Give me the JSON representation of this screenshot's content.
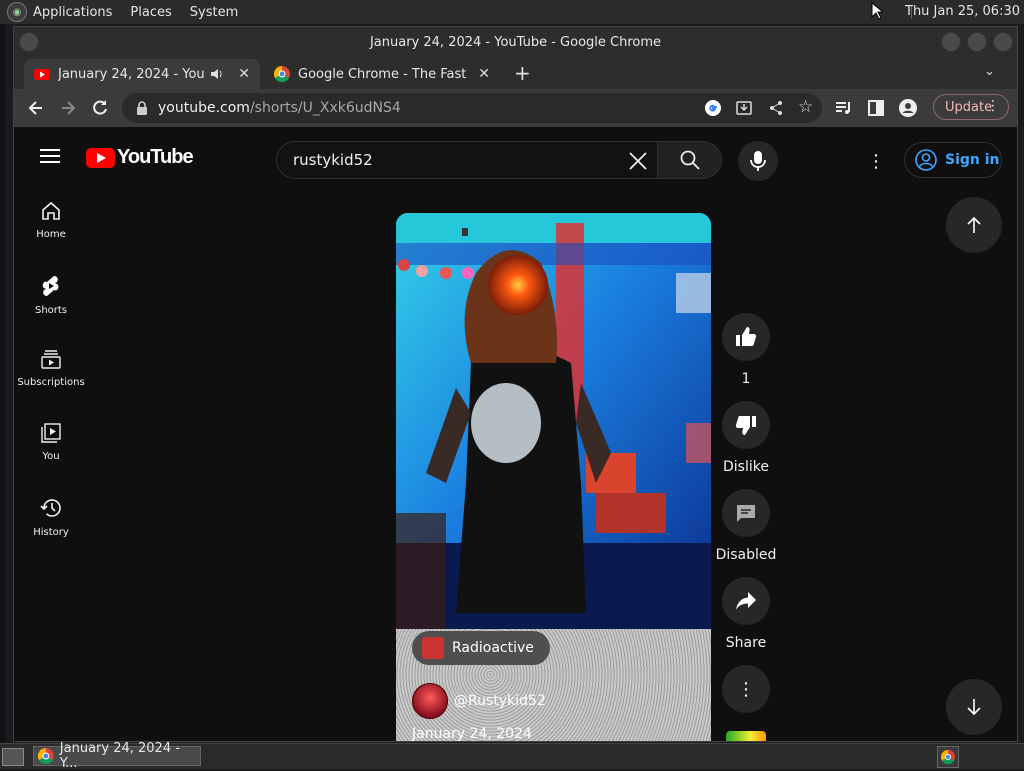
{
  "desktop": {
    "menu": [
      "Applications",
      "Places",
      "System"
    ],
    "clock": "Thu Jan 25, 06:30"
  },
  "window": {
    "title": "January 24, 2024 - YouTube - Google Chrome"
  },
  "tabs": [
    {
      "label": "January 24, 2024 - YouTube",
      "favicon": "youtube-icon",
      "audio": true
    },
    {
      "label": "Google Chrome - The Fast & Secure Web Browser",
      "favicon": "chrome-icon"
    }
  ],
  "address": {
    "host": "youtube.com",
    "path": "/shorts/U_Xxk6udNS4"
  },
  "toolbar": {
    "update_label": "Update"
  },
  "youtube": {
    "logo_text": "YouTube",
    "search_value": "rustykid52",
    "signin_label": "Sign in",
    "guide": [
      {
        "label": "Home",
        "icon": "home-icon"
      },
      {
        "label": "Shorts",
        "icon": "shorts-icon"
      },
      {
        "label": "Subscriptions",
        "icon": "subscriptions-icon"
      },
      {
        "label": "You",
        "icon": "you-icon"
      },
      {
        "label": "History",
        "icon": "history-icon"
      }
    ],
    "short": {
      "audio_label": "Radioactive",
      "channel": "@Rustykid52",
      "date": "January 24, 2024"
    },
    "actions": {
      "like_count": "1",
      "dislike_label": "Dislike",
      "comments_label": "Disabled",
      "share_label": "Share"
    }
  },
  "taskbar": {
    "item_label": "January 24, 2024 - Y..."
  },
  "colors": {
    "yt_red": "#ff0000",
    "yt_bg": "#0f0f0f",
    "signin_blue": "#3ea6ff",
    "update_text": "#f2b8b5"
  }
}
